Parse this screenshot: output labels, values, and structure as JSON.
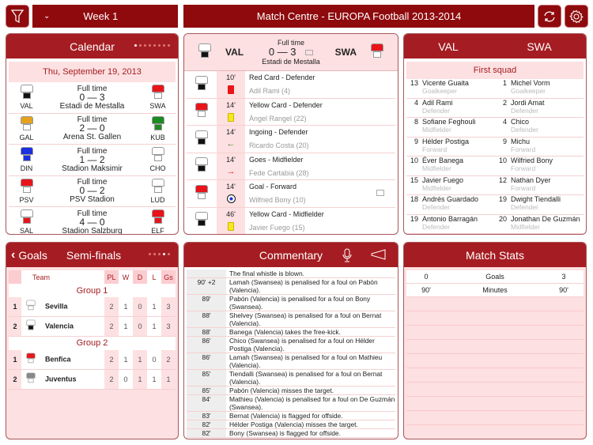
{
  "toolbar": {
    "week": "Week 1",
    "title": "Match Centre - EUROPA Football 2013-2014",
    "filter_icon": "filter-icon",
    "refresh_icon": "refresh-icon",
    "settings_icon": "gear-icon"
  },
  "calendar": {
    "title": "Calendar",
    "date": "Thu, September 19, 2013",
    "page_dots": 8,
    "active_dot": 0,
    "matches": [
      {
        "status": "Full time",
        "home": "VAL",
        "away": "SWA",
        "score": "0 — 3",
        "venue": "Estadi de Mestalla",
        "hk": [
          "#ffffff",
          "#111111"
        ],
        "ak": [
          "#e8141a",
          "#ffffff"
        ]
      },
      {
        "status": "Full time",
        "home": "GAL",
        "away": "KUB",
        "score": "2 — 0",
        "venue": "Arena St. Gallen",
        "hk": [
          "#e6a21c",
          "#ffffff"
        ],
        "ak": [
          "#1e8a24",
          "#1e8a24"
        ]
      },
      {
        "status": "Full time",
        "home": "DIN",
        "away": "CHO",
        "score": "1 — 2",
        "venue": "Stadion Maksimir",
        "hk": [
          "#1a2fe0",
          "#1a2fe0"
        ],
        "ak": [
          "#ffffff",
          "#ffffff"
        ]
      },
      {
        "status": "Full time",
        "home": "PSV",
        "away": "LUD",
        "score": "0 — 2",
        "venue": "PSV Stadion",
        "hk": [
          "#e8141a",
          "#ffffff"
        ],
        "ak": [
          "#ffffff",
          "#ffffff"
        ]
      },
      {
        "status": "Full time",
        "home": "SAL",
        "away": "ELF",
        "score": "4 — 0",
        "venue": "Stadion Salzburg",
        "hk": [
          "#ffffff",
          "#e8141a"
        ],
        "ak": [
          "#e8141a",
          "#e8141a"
        ]
      }
    ]
  },
  "match": {
    "status": "Full time",
    "home": "VAL",
    "away": "SWA",
    "score": "0 — 3",
    "venue": "Estadi de Mestalla",
    "events": [
      {
        "min": "10'",
        "title": "Red Card - Defender",
        "player": "Adil Rami (4)",
        "icon": "red-card-icon",
        "team": "home"
      },
      {
        "min": "14'",
        "title": "Yellow Card - Defender",
        "player": "Àngel Rangel (22)",
        "icon": "yellow-card-icon",
        "team": "away"
      },
      {
        "min": "14'",
        "title": "Ingoing - Defender",
        "player": "Ricardo Costa (20)",
        "icon": "arrow-in-icon",
        "team": "home"
      },
      {
        "min": "14'",
        "title": "Goes - Midfielder",
        "player": "Fede Cartabia (28)",
        "icon": "arrow-out-icon",
        "team": "home"
      },
      {
        "min": "14'",
        "title": "Goal - Forward",
        "player": "Wilfried Bony (10)",
        "icon": "ball-icon",
        "team": "away",
        "video": true
      },
      {
        "min": "46'",
        "title": "Yellow Card - Midfielder",
        "player": "Javier Fuego (15)",
        "icon": "yellow-card-icon",
        "team": "home"
      }
    ]
  },
  "lineup": {
    "home": "VAL",
    "away": "SWA",
    "section": "First squad",
    "rows": [
      [
        {
          "n": "13",
          "name": "Vicente Guaita",
          "pos": "Goalkeeper"
        },
        {
          "n": "1",
          "name": "Michel Vorm",
          "pos": "Goalkeeper"
        }
      ],
      [
        {
          "n": "4",
          "name": "Adil Rami",
          "pos": "Defender"
        },
        {
          "n": "2",
          "name": "Jordi Amat",
          "pos": "Defender"
        }
      ],
      [
        {
          "n": "8",
          "name": "Sofiane Feghouli",
          "pos": "Midfielder"
        },
        {
          "n": "4",
          "name": "Chico",
          "pos": "Defender"
        }
      ],
      [
        {
          "n": "9",
          "name": "Hélder Postiga",
          "pos": "Forward"
        },
        {
          "n": "9",
          "name": "Michu",
          "pos": "Forward"
        }
      ],
      [
        {
          "n": "10",
          "name": "Éver Banega",
          "pos": "Midfielder"
        },
        {
          "n": "10",
          "name": "Wilfried Bony",
          "pos": "Forward"
        }
      ],
      [
        {
          "n": "15",
          "name": "Javier Fuego",
          "pos": "Midfielder"
        },
        {
          "n": "12",
          "name": "Nathan Dyer",
          "pos": "Forward"
        }
      ],
      [
        {
          "n": "18",
          "name": "Andrés Guardado",
          "pos": "Defender"
        },
        {
          "n": "19",
          "name": "Dwight Tiendalli",
          "pos": "Defender"
        }
      ],
      [
        {
          "n": "19",
          "name": "Antonio Barragán",
          "pos": "Defender"
        },
        {
          "n": "20",
          "name": "Jonathan De Guzmán",
          "pos": "Midfielder"
        }
      ]
    ]
  },
  "standings": {
    "back": "Goals",
    "title": "Semi-finals",
    "page_dots": 5,
    "active_dot": 3,
    "headers": [
      "",
      "Team",
      "PL",
      "W",
      "D",
      "L",
      "Gs"
    ],
    "groups": [
      {
        "name": "Group 1",
        "rows": [
          [
            "1",
            "Sevilla",
            "2",
            "1",
            "0",
            "1",
            "3"
          ],
          [
            "2",
            "Valencia",
            "2",
            "1",
            "0",
            "1",
            "3"
          ]
        ]
      },
      {
        "name": "Group 2",
        "rows": [
          [
            "1",
            "Benfica",
            "2",
            "1",
            "1",
            "0",
            "2"
          ],
          [
            "2",
            "Juventus",
            "2",
            "0",
            "1",
            "1",
            "1"
          ]
        ]
      }
    ]
  },
  "commentary": {
    "title": "Commentary",
    "items": [
      {
        "t": "",
        "x": "The final whistle is blown."
      },
      {
        "t": "90' +2",
        "x": "Lamah (Swansea) is penalised for a foul on  Pabón (Valencia)."
      },
      {
        "t": "89'",
        "x": "Pabón (Valencia) is penalised for a foul on  Bony (Swansea)."
      },
      {
        "t": "88'",
        "x": "Shelvey (Swansea) is penalised for a foul on  Bernat (Valencia)."
      },
      {
        "t": "88'",
        "x": "Banega (Valencia) takes the free-kick."
      },
      {
        "t": "86'",
        "x": "Chico (Swansea) is penalised for a foul on  Hélder Postiga (Valencia)."
      },
      {
        "t": "86'",
        "x": "Lamah (Swansea) is penalised for a foul on  Mathieu (Valencia)."
      },
      {
        "t": "85'",
        "x": "Tiendalli (Swansea) is penalised for a foul on  Bernat (Valencia)."
      },
      {
        "t": "85'",
        "x": "Pabón (Valencia) misses the target."
      },
      {
        "t": "84'",
        "x": "Mathieu (Valencia) is penalised for a foul on  De Guzmán (Swansea)."
      },
      {
        "t": "83'",
        "x": "Bernat (Valencia) is flagged for offside."
      },
      {
        "t": "82'",
        "x": "Hélder Postiga (Valencia) misses the target."
      },
      {
        "t": "82'",
        "x": "Bony (Swansea) is flagged for offside."
      }
    ]
  },
  "stats": {
    "title": "Match Stats",
    "rows": [
      [
        "0",
        "Goals",
        "3"
      ],
      [
        "90'",
        "Minutes",
        "90'"
      ]
    ]
  }
}
